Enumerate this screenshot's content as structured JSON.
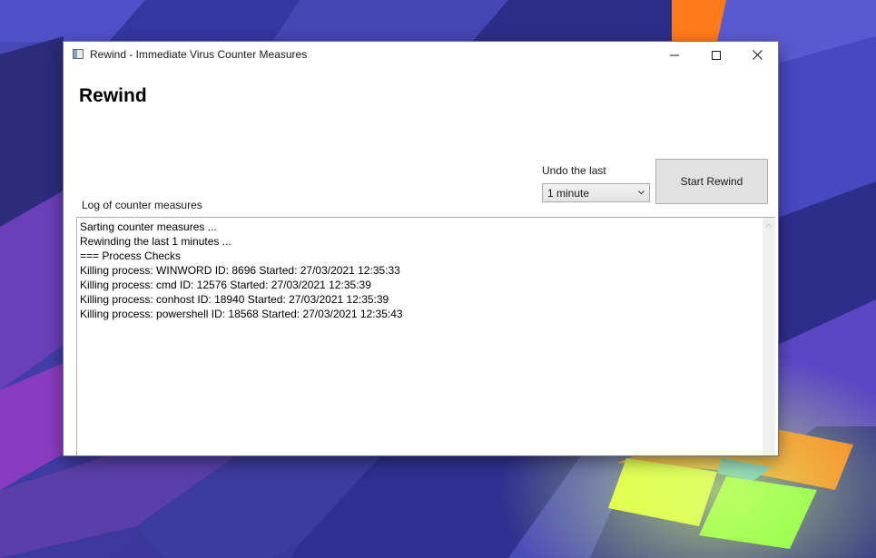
{
  "window": {
    "title": "Rewind - Immediate Virus Counter Measures",
    "controls": {
      "minimize_icon": "minimize-icon",
      "maximize_icon": "maximize-icon",
      "close_icon": "close-icon"
    }
  },
  "main": {
    "heading": "Rewind",
    "undo_label": "Undo the last",
    "undo_selected": "1 minute",
    "start_button": "Start Rewind",
    "log_label": "Log of counter measures",
    "log_lines": [
      "Sarting counter measures ...",
      "Rewinding the last 1 minutes ...",
      "=== Process Checks",
      "Killing process: WINWORD ID: 8696 Started: 27/03/2021 12:35:33",
      "Killing process: cmd ID: 12576 Started: 27/03/2021 12:35:39",
      "Killing process: conhost ID: 18940 Started: 27/03/2021 12:35:39",
      "Killing process: powershell ID: 18568 Started: 27/03/2021 12:35:43"
    ]
  },
  "colors": {
    "window_background": "#ffffff",
    "button_face": "#e1e1e1",
    "border": "#adadad",
    "desktop_base": "#3a3a9a",
    "accent_orange": "#ff7a1a",
    "accent_yellow": "#e8ff3a",
    "accent_green": "#7cff3a"
  }
}
